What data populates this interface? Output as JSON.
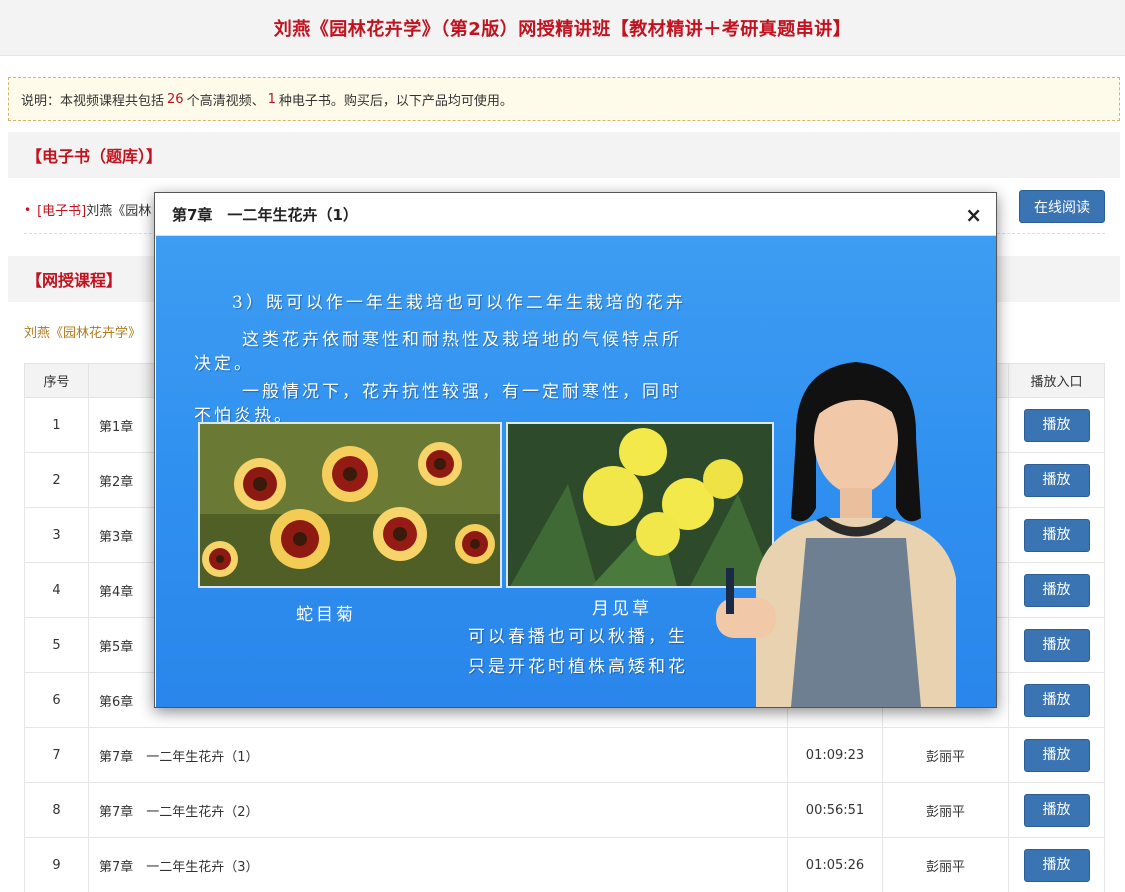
{
  "page": {
    "title": "刘燕《园林花卉学》（第2版）网授精讲班【教材精讲＋考研真题串讲】"
  },
  "notice": {
    "prefix": "说明：本视频课程共包括",
    "video_count": "26",
    "mid1": "个高清视频、",
    "ebook_count": "1",
    "suffix": "种电子书。购买后，以下产品均可使用。"
  },
  "ebook_section": {
    "heading": "【电子书（题库）】",
    "item": {
      "bullet": "•",
      "tag": "[电子书]",
      "name": "刘燕《园林",
      "button": "在线阅读"
    }
  },
  "course_section": {
    "heading": "【网授课程】",
    "subtitle": "刘燕《园林花卉学》"
  },
  "table": {
    "headers": {
      "num": "序号",
      "play": "播放入口"
    },
    "play_label": "播放",
    "rows": [
      {
        "num": "1",
        "title": "第1章",
        "duration": "",
        "teacher": ""
      },
      {
        "num": "2",
        "title": "第2章",
        "duration": "",
        "teacher": ""
      },
      {
        "num": "3",
        "title": "第3章",
        "duration": "",
        "teacher": ""
      },
      {
        "num": "4",
        "title": "第4章",
        "duration": "",
        "teacher": ""
      },
      {
        "num": "5",
        "title": "第5章",
        "duration": "",
        "teacher": ""
      },
      {
        "num": "6",
        "title": "第6章",
        "duration": "",
        "teacher": ""
      },
      {
        "num": "7",
        "title": "第7章　一二年生花卉（1）",
        "duration": "01:09:23",
        "teacher": "彭丽平"
      },
      {
        "num": "8",
        "title": "第7章　一二年生花卉（2）",
        "duration": "00:56:51",
        "teacher": "彭丽平"
      },
      {
        "num": "9",
        "title": "第7章　一二年生花卉（3）",
        "duration": "01:05:26",
        "teacher": "彭丽平"
      }
    ]
  },
  "modal": {
    "title": "第7章　一二年生花卉（1）",
    "close": "×",
    "slide": {
      "line1": "3）既可以作一年生栽培也可以作二年生栽培的花卉",
      "line2": "这类花卉依耐寒性和耐热性及栽培地的气候特点所",
      "line3": "决定。",
      "line4": "一般情况下，花卉抗性较强，有一定耐寒性，同时",
      "line5": "不怕炎热。",
      "caption_left": "蛇目菊",
      "caption_right": "月见草",
      "line6": "可以春播也可以秋播，生",
      "line7": "只是开花时植株高矮和花"
    }
  },
  "colors": {
    "accent_red": "#c1121f",
    "button_blue": "#3b74b3",
    "video_blue": "#2f8ff0"
  }
}
